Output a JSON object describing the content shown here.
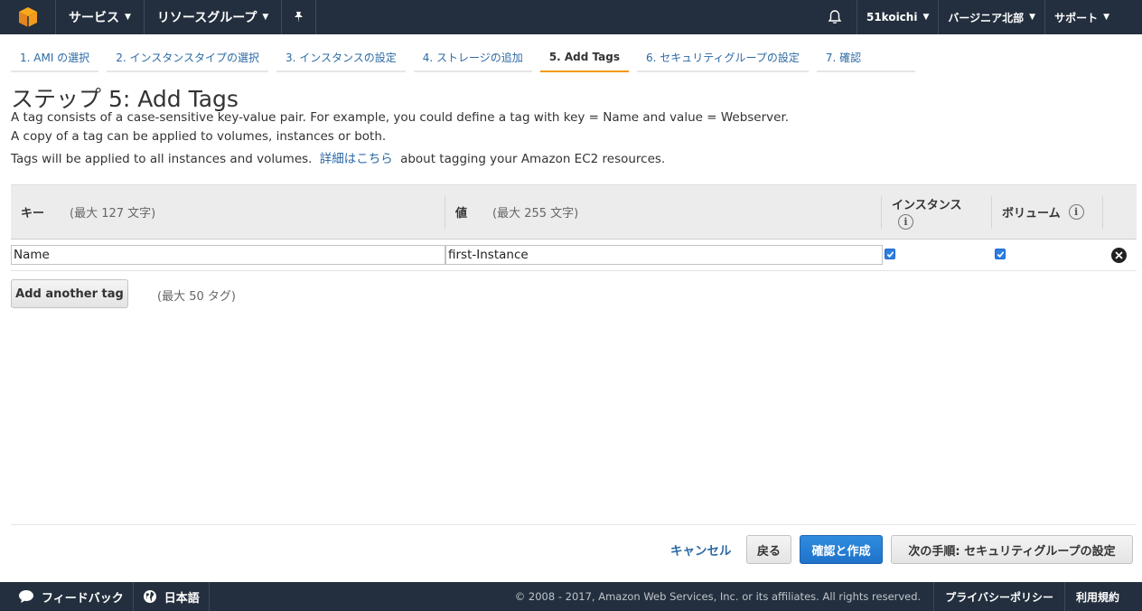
{
  "topnav": {
    "services": "サービス",
    "resource_groups": "リソースグループ",
    "account": "51koichi",
    "region": "バージニア北部",
    "support": "サポート"
  },
  "tabs": [
    {
      "label": "1. AMI の選択"
    },
    {
      "label": "2. インスタンスタイプの選択"
    },
    {
      "label": "3. インスタンスの設定"
    },
    {
      "label": "4. ストレージの追加"
    },
    {
      "label": "5. Add Tags"
    },
    {
      "label": "6. セキュリティグループの設定"
    },
    {
      "label": "7. 確認"
    }
  ],
  "heading": "ステップ 5: Add Tags",
  "description": {
    "line1": "A tag consists of a case-sensitive key-value pair. For example, you could define a tag with key = Name and value = Webserver.",
    "line2": "A copy of a tag can be applied to volumes, instances or both.",
    "line3_pre": "Tags will be applied to all instances and volumes.",
    "line3_link": "詳細はこちら",
    "line3_post": "about tagging your Amazon EC2 resources."
  },
  "table": {
    "key_header": "キー",
    "key_hint": "(最大 127 文字)",
    "value_header": "値",
    "value_hint": "(最大 255 文字)",
    "instance_header": "インスタンス",
    "volume_header": "ボリューム",
    "rows": [
      {
        "key": "Name",
        "value": "first-Instance",
        "instance": true,
        "volume": true
      }
    ]
  },
  "add_tag_button": "Add another tag",
  "add_tag_note": "(最大 50 タグ)",
  "actions": {
    "cancel": "キャンセル",
    "back": "戻る",
    "review": "確認と作成",
    "next": "次の手順: セキュリティグループの設定"
  },
  "footer": {
    "feedback": "フィードバック",
    "language": "日本語",
    "copyright": "© 2008 - 2017, Amazon Web Services, Inc. or its affiliates. All rights reserved.",
    "privacy": "プライバシーポリシー",
    "terms": "利用規約"
  },
  "colors": {
    "nav_bg": "#232f3e",
    "link": "#2c6aa5",
    "active_tab": "#f29900",
    "primary_button": "#1f73c9"
  }
}
